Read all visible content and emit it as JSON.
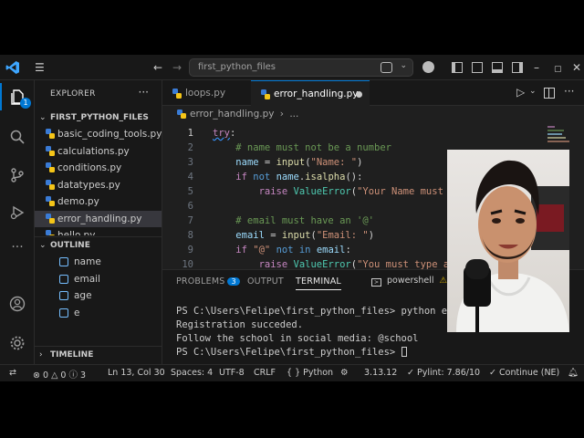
{
  "titlebar": {
    "search_text": "first_python_files"
  },
  "sidebar": {
    "explorer_title": "EXPLORER",
    "folder_name": "FIRST_PYTHON_FILES",
    "files": [
      {
        "label": "basic_coding_tools.py"
      },
      {
        "label": "calculations.py"
      },
      {
        "label": "conditions.py"
      },
      {
        "label": "datatypes.py"
      },
      {
        "label": "demo.py"
      },
      {
        "label": "error_handling.py"
      },
      {
        "label": "hello.py"
      }
    ],
    "outline_title": "OUTLINE",
    "outline_items": [
      {
        "label": "name"
      },
      {
        "label": "email"
      },
      {
        "label": "age"
      },
      {
        "label": "e"
      }
    ],
    "timeline_title": "TIMELINE",
    "accounts_badge": "1"
  },
  "editor": {
    "tabs": [
      {
        "label": "loops.py"
      },
      {
        "label": "error_handling.py"
      }
    ],
    "breadcrumb": {
      "file": "error_handling.py",
      "more": "..."
    },
    "lines": [
      {
        "n": "1",
        "text": "try:"
      },
      {
        "n": "2",
        "text": "    # name must not be a number"
      },
      {
        "n": "3",
        "text": "    name = input(\"Name: \")"
      },
      {
        "n": "4",
        "text": "    if not name.isalpha():"
      },
      {
        "n": "5",
        "text": "        raise ValueError(\"Your Name must"
      },
      {
        "n": "6",
        "text": ""
      },
      {
        "n": "7",
        "text": "    # email must have an '@'"
      },
      {
        "n": "8",
        "text": "    email = input(\"Email: \")"
      },
      {
        "n": "9",
        "text": "    if \"@\" not in email:"
      },
      {
        "n": "10",
        "text": "        raise ValueError(\"You must type a"
      }
    ]
  },
  "panel": {
    "problems_label": "PROBLEMS",
    "problems_count": "3",
    "output_label": "OUTPUT",
    "terminal_label": "TERMINAL",
    "shell_label": "powershell",
    "terminal_lines": [
      "PS C:\\Users\\Felipe\\first_python_files> python err",
      "Registration succeded.",
      "Follow the school in social media: @school",
      "PS C:\\Users\\Felipe\\first_python_files> "
    ]
  },
  "statusbar": {
    "errors": "0",
    "warnings": "0",
    "info": "3",
    "position": "Ln 13, Col 30",
    "spaces": "Spaces: 4",
    "encoding": "UTF-8",
    "eol": "CRLF",
    "language": "Python",
    "python_version": "3.13.12",
    "pylint": "Pylint: 7.86/10",
    "continue": "Continue (NE)"
  }
}
